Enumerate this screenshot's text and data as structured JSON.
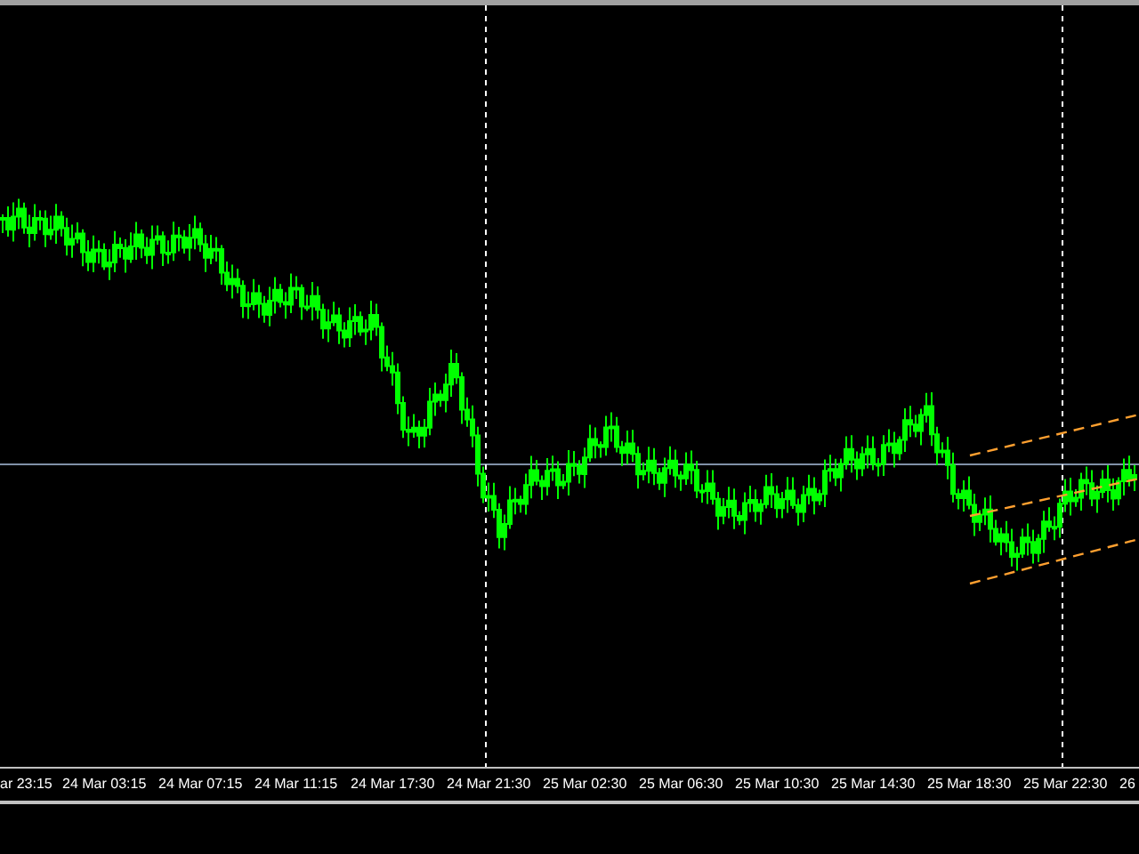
{
  "chart": {
    "time_axis": [
      {
        "label": "ar 23:15"
      },
      {
        "label": "24 Mar 03:15"
      },
      {
        "label": "24 Mar 07:15"
      },
      {
        "label": "24 Mar 11:15"
      },
      {
        "label": "24 Mar 17:30"
      },
      {
        "label": "24 Mar 21:30"
      },
      {
        "label": "25 Mar 02:30"
      },
      {
        "label": "25 Mar 06:30"
      },
      {
        "label": "25 Mar 10:30"
      },
      {
        "label": "25 Mar 14:30"
      },
      {
        "label": "25 Mar 18:30"
      },
      {
        "label": "25 Mar 22:30"
      },
      {
        "label": "26"
      }
    ]
  }
}
